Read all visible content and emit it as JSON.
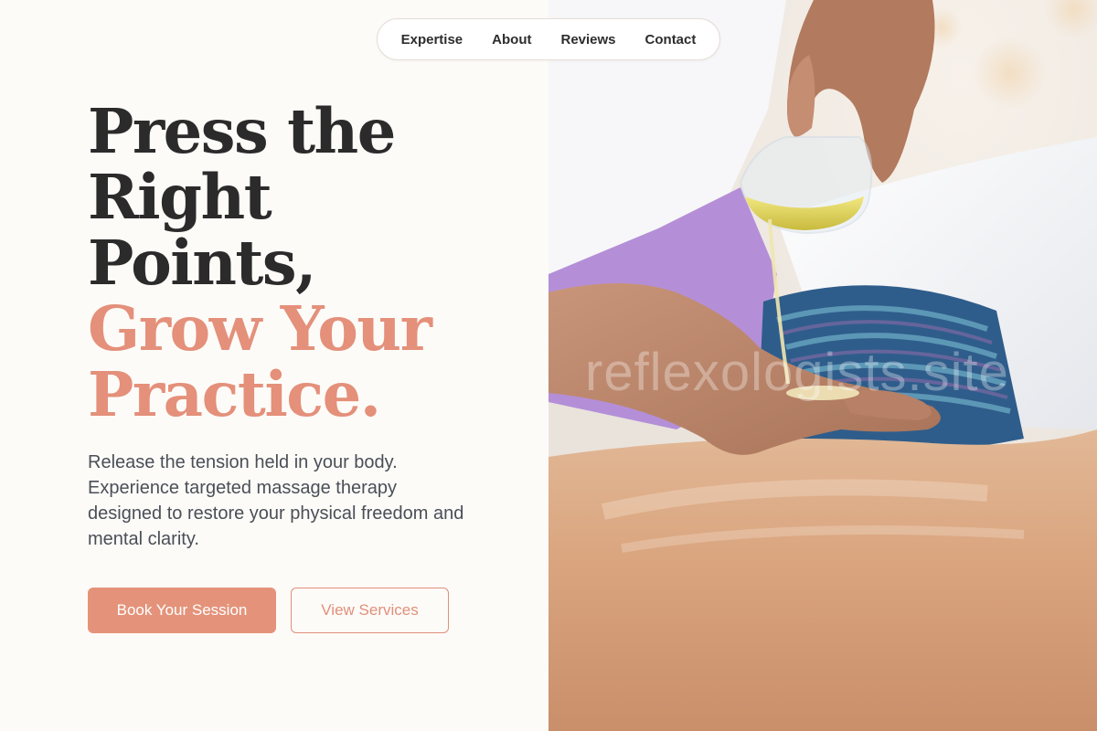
{
  "nav": {
    "items": [
      {
        "label": "Expertise"
      },
      {
        "label": "About"
      },
      {
        "label": "Reviews"
      },
      {
        "label": "Contact"
      }
    ]
  },
  "hero": {
    "headline_dark": [
      "Press the",
      "Right",
      "Points,"
    ],
    "headline_accent": [
      "Grow Your",
      "Practice."
    ],
    "description": "Release the tension held in your body. Experience targeted massage therapy designed to restore your physical freedom and mental clarity.",
    "primary_button": "Book Your Session",
    "secondary_button": "View Services"
  },
  "image": {
    "watermark": "reflexologists.site",
    "subject": "massage-oil-pouring-photo"
  },
  "colors": {
    "accent": "#e4907a",
    "text_dark": "#2b2b2b",
    "text_body": "#4a4f57",
    "background": "#fdfbf8"
  }
}
